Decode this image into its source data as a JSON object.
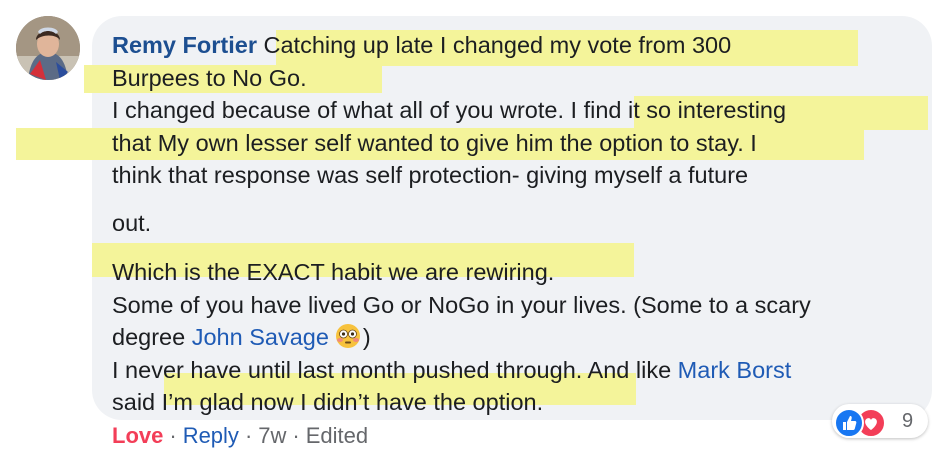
{
  "comment": {
    "author": "Remy Fortier",
    "lines": {
      "l1": "Catching up late I changed my vote from 300",
      "l2": "Burpees to No Go.",
      "l3a": "I changed because of what all of you wrote.",
      "l3b": "I find it so interesting",
      "l4": "that My own lesser self wanted to give him the option to stay. I",
      "l5": "think that response was self protection- giving myself a future",
      "l6": "out.",
      "l7": "Which is the EXACT habit we are rewiring.",
      "l8": "Some of you have lived Go or NoGo in your lives. (Some to a scary",
      "l9a": "degree",
      "l9_mention": "John Savage",
      "l9b": ")",
      "l10a": "I never have until last month pushed through. And like",
      "l10_mention": "Mark Borst",
      "l11a": "said",
      "l11b": "I’m glad now I didn’t have the option."
    },
    "emoji": "flushed-face-emoji"
  },
  "reactions": {
    "count": "9",
    "icons": [
      "like-icon",
      "love-icon"
    ],
    "colors": {
      "like": "#1877f2",
      "love": "#f33e58"
    }
  },
  "actions": {
    "love_label": "Love",
    "reply_label": "Reply",
    "time": "7w",
    "edited": "Edited",
    "separator": "·"
  },
  "colors": {
    "highlight": "#f4f49a",
    "bubble": "#f0f2f5",
    "link": "#1f5bb5"
  }
}
